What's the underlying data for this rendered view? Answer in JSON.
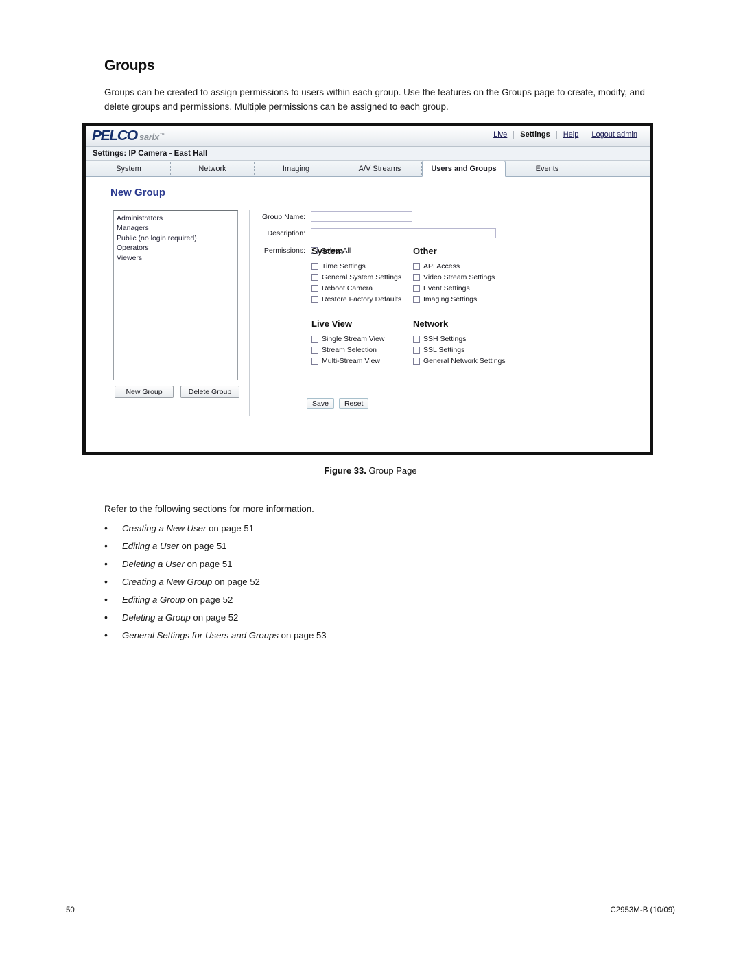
{
  "document": {
    "heading": "Groups",
    "intro": "Groups can be created to assign permissions to users within each group. Use the features on the Groups page to create, modify, and delete groups and permissions. Multiple permissions can be assigned to each group.",
    "figure_caption_label": "Figure 33.",
    "figure_caption_text": "Group Page",
    "refer_text": "Refer to the following sections for more information.",
    "bullets": [
      {
        "title": "Creating a New User",
        "suffix": " on page 51"
      },
      {
        "title": "Editing a User",
        "suffix": " on page 51"
      },
      {
        "title": "Deleting a User",
        "suffix": " on page 51"
      },
      {
        "title": "Creating a New Group",
        "suffix": " on page 52"
      },
      {
        "title": "Editing a Group",
        "suffix": " on page 52"
      },
      {
        "title": "Deleting a Group",
        "suffix": " on page 52"
      },
      {
        "title": "General Settings for Users and Groups",
        "suffix": " on page 53"
      }
    ],
    "footer": {
      "page_number": "50",
      "doc_code": "C2953M-B (10/09)"
    }
  },
  "screenshot": {
    "brand": {
      "name": "PELCO",
      "product": "sarix",
      "trademark": "™"
    },
    "top_links": [
      {
        "label": "Live",
        "active": false
      },
      {
        "label": "Settings",
        "active": true
      },
      {
        "label": "Help",
        "active": false
      },
      {
        "label": "Logout admin",
        "active": false
      }
    ],
    "settings_bar": "Settings: IP Camera - East Hall",
    "tabs": [
      {
        "label": "System",
        "active": false
      },
      {
        "label": "Network",
        "active": false
      },
      {
        "label": "Imaging",
        "active": false
      },
      {
        "label": "A/V Streams",
        "active": false
      },
      {
        "label": "Users and Groups",
        "active": true
      },
      {
        "label": "Events",
        "active": false
      }
    ],
    "section_title": "New Group",
    "group_list": [
      "Administrators",
      "Managers",
      "Public (no login required)",
      "Operators",
      "Viewers"
    ],
    "list_buttons": [
      {
        "label": "New Group"
      },
      {
        "label": "Delete Group"
      }
    ],
    "form": {
      "group_name_label": "Group Name:",
      "group_name_value": "",
      "description_label": "Description:",
      "description_value": "",
      "permissions_label": "Permissions:",
      "select_all_label": "Select All",
      "select_all_checked": false
    },
    "permission_blocks": [
      {
        "heading": "System",
        "items": [
          {
            "label": "Time Settings",
            "checked": false
          },
          {
            "label": "General System Settings",
            "checked": false
          },
          {
            "label": "Reboot Camera",
            "checked": false
          },
          {
            "label": "Restore Factory Defaults",
            "checked": false
          }
        ]
      },
      {
        "heading": "Other",
        "items": [
          {
            "label": "API Access",
            "checked": false
          },
          {
            "label": "Video Stream Settings",
            "checked": false
          },
          {
            "label": "Event Settings",
            "checked": false
          },
          {
            "label": "Imaging Settings",
            "checked": false
          }
        ]
      },
      {
        "heading": "Live View",
        "items": [
          {
            "label": "Single Stream View",
            "checked": false
          },
          {
            "label": "Stream Selection",
            "checked": false
          },
          {
            "label": "Multi-Stream View",
            "checked": false
          }
        ]
      },
      {
        "heading": "Network",
        "items": [
          {
            "label": "SSH Settings",
            "checked": false
          },
          {
            "label": "SSL Settings",
            "checked": false
          },
          {
            "label": "General Network Settings",
            "checked": false
          }
        ]
      }
    ],
    "action_buttons": [
      {
        "label": "Save"
      },
      {
        "label": "Reset"
      }
    ],
    "colors": {
      "brand_navy": "#16306b",
      "section_title_blue": "#2b3a8f",
      "frame_black": "#111111"
    }
  }
}
